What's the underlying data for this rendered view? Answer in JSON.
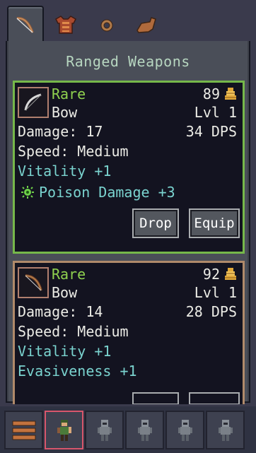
{
  "tabs": [
    {
      "name": "bow-tab",
      "icon": "bow-icon",
      "active": true
    },
    {
      "name": "armor-tab",
      "icon": "armor-icon",
      "active": false
    },
    {
      "name": "ring-tab",
      "icon": "ring-icon",
      "active": false
    },
    {
      "name": "boots-tab",
      "icon": "boots-icon",
      "active": false
    }
  ],
  "panel": {
    "title": "Ranged Weapons"
  },
  "items": [
    {
      "rarity": "Rare",
      "type": "Bow",
      "price": "89",
      "level": "Lvl 1",
      "damage": "Damage: 17",
      "dps": "34 DPS",
      "speed": "Speed: Medium",
      "bonus1": "Vitality +1",
      "bonus2": "Poison Damage +3",
      "bonus2_icon": "poison-icon",
      "drop_label": "Drop",
      "equip_label": "Equip"
    },
    {
      "rarity": "Rare",
      "type": "Bow",
      "price": "92",
      "level": "Lvl 1",
      "damage": "Damage: 14",
      "dps": "28 DPS",
      "speed": "Speed: Medium",
      "bonus1": "Vitality +1",
      "bonus2": "Evasiveness +1"
    }
  ],
  "colors": {
    "rare": "#8fd14f",
    "bonus": "#7ad3cf",
    "card1_border": "#76b84a",
    "card2_border": "#b08a6a",
    "selected_slot": "#d8566c"
  },
  "bottom_bar": {
    "menu_icon": "hamburger-menu-icon",
    "characters": [
      {
        "name": "hero-1",
        "selected": true
      },
      {
        "name": "hero-2",
        "selected": false
      },
      {
        "name": "hero-3",
        "selected": false
      },
      {
        "name": "hero-4",
        "selected": false
      },
      {
        "name": "hero-5",
        "selected": false
      }
    ]
  }
}
